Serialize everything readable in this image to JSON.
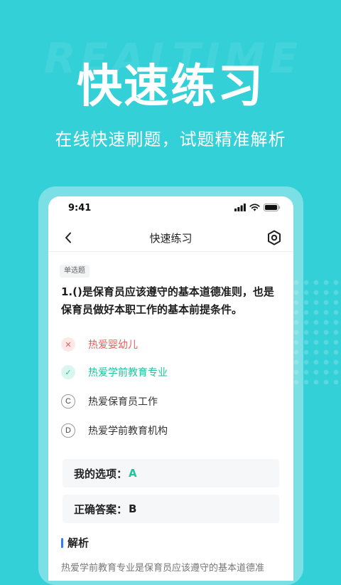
{
  "hero": {
    "watermark": "REALTIME",
    "title": "快速练习",
    "subtitle": "在线快速刷题，试题精准解析"
  },
  "phone": {
    "status_time": "9:41",
    "nav_title": "快速练习",
    "question_type": "单选题",
    "question": "1.()是保育员应该遵守的基本道德准则，也是保育员做好本职工作的基本前提条件。",
    "options": [
      {
        "mark": "✕",
        "text": "热爱婴幼儿",
        "state": "wrong"
      },
      {
        "mark": "✓",
        "text": "热爱学前教育专业",
        "state": "right"
      },
      {
        "mark": "C",
        "text": "热爱保育员工作",
        "state": "normal"
      },
      {
        "mark": "D",
        "text": "热爱学前教育机构",
        "state": "normal"
      }
    ],
    "my_choice_label": "我的选项：",
    "my_choice_value": "A",
    "correct_label": "正确答案：",
    "correct_value": "B",
    "analysis_label": "解析",
    "analysis_text": "热爱学前教育专业是保育员应该遵守的基本道德准"
  },
  "colors": {
    "background": "#34D0D8",
    "wrong": "#F05A5A",
    "right": "#1EC49B",
    "accent": "#2F7FF3"
  }
}
